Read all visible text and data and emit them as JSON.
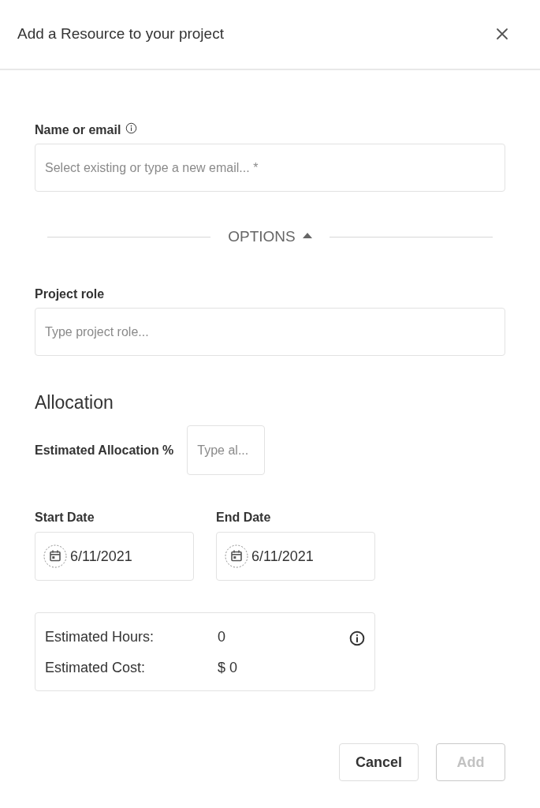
{
  "dialog": {
    "title": "Add a Resource to your project"
  },
  "name_field": {
    "label": "Name or email",
    "placeholder": "Select existing or type a new email... *"
  },
  "options_toggle": {
    "label": "OPTIONS",
    "expanded": true
  },
  "role_field": {
    "label": "Project role",
    "placeholder": "Type project role..."
  },
  "allocation": {
    "heading": "Allocation",
    "percent_field": {
      "label": "Estimated Allocation %",
      "placeholder": "Type al..."
    }
  },
  "dates": [
    {
      "label": "Start Date",
      "value": "6/11/2021"
    },
    {
      "label": "End Date",
      "value": "6/11/2021"
    }
  ],
  "estimates": [
    {
      "label": "Estimated Hours:",
      "value": "0"
    },
    {
      "label": "Estimated Cost:",
      "value": "$ 0"
    }
  ],
  "buttons": [
    {
      "label": "Cancel",
      "disabled": false
    },
    {
      "label": "Add",
      "disabled": true
    }
  ]
}
